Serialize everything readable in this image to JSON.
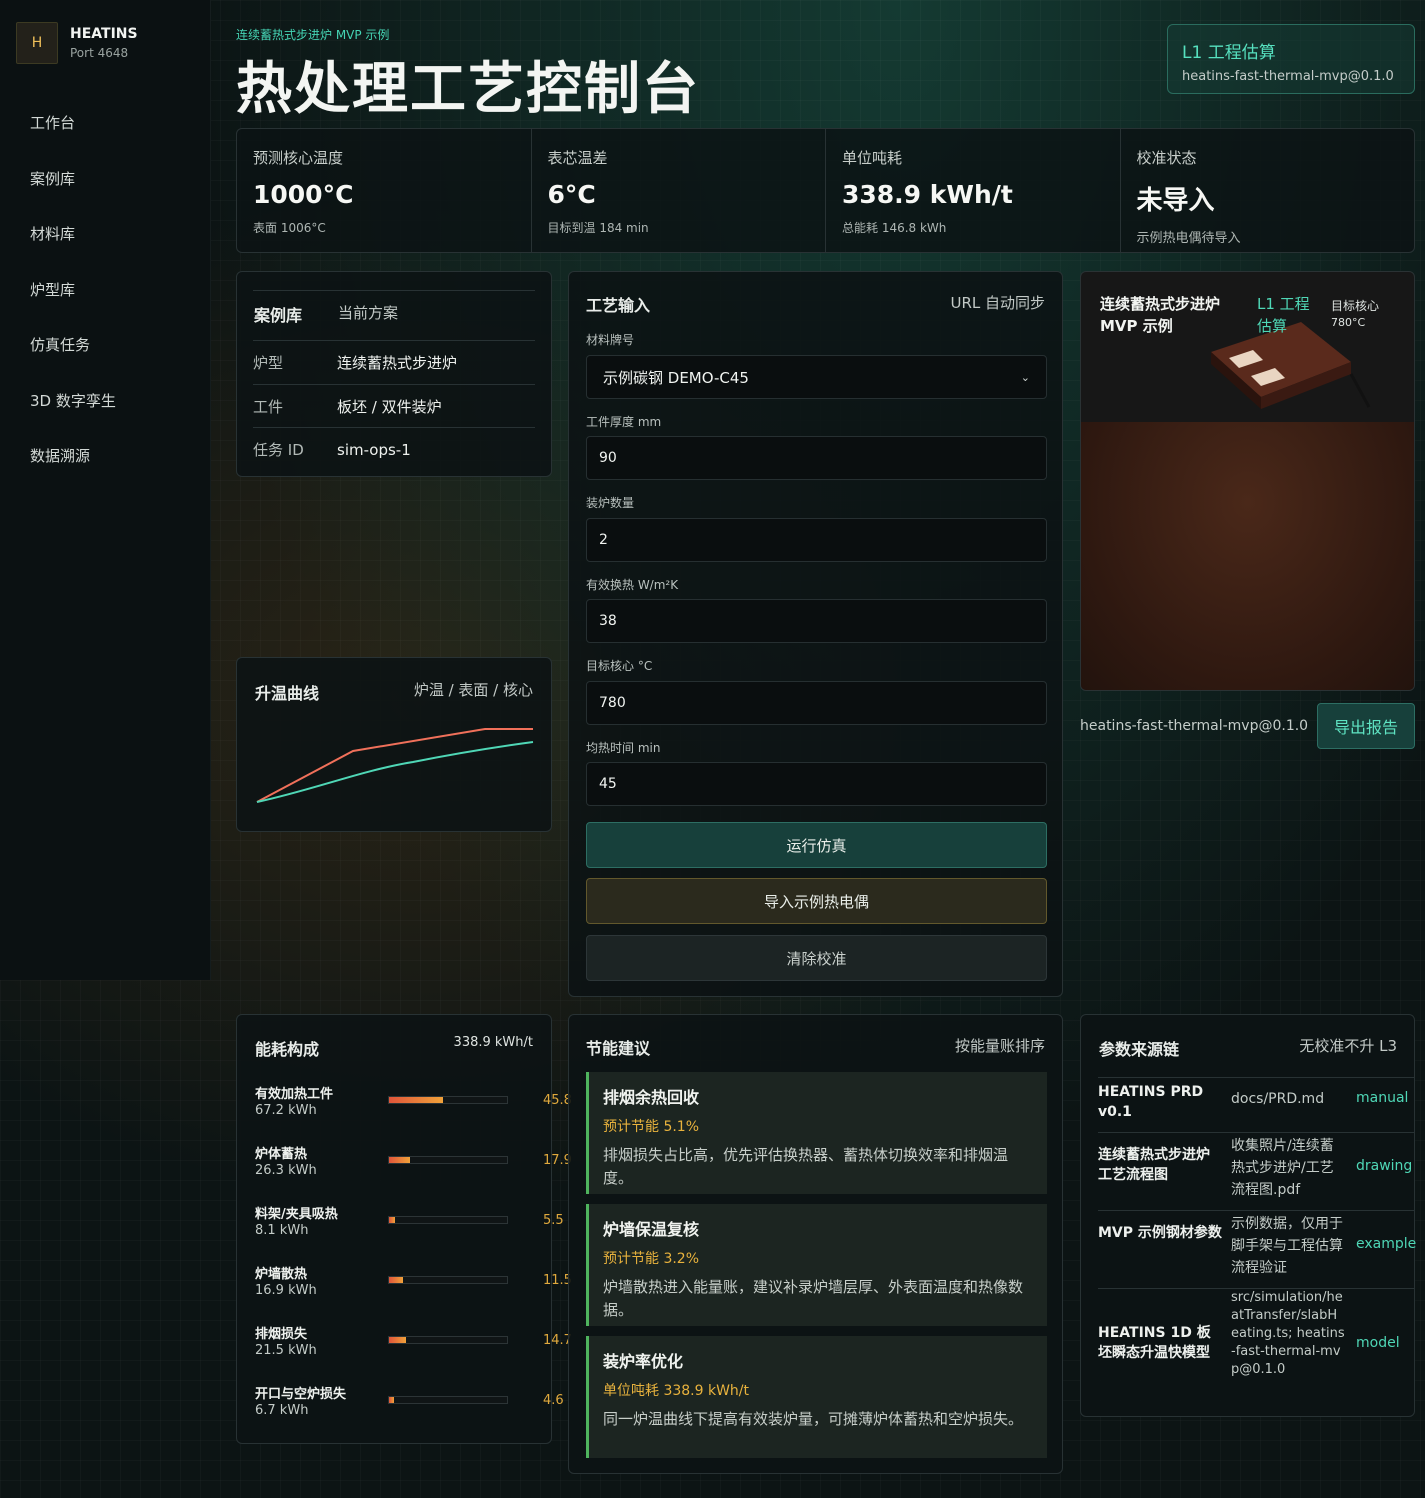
{
  "sidebar": {
    "logo_letter": "H",
    "brand": "HEATINS",
    "port": "Port 4648",
    "items": [
      "工作台",
      "案例库",
      "材料库",
      "炉型库",
      "仿真任务",
      "3D 数字孪生",
      "数据溯源"
    ]
  },
  "header": {
    "eyebrow": "连续蓄热式步进炉 MVP 示例",
    "title": "热处理工艺控制台",
    "badge_title": "L1 工程估算",
    "badge_sub": "heatins-fast-thermal-mvp@0.1.0"
  },
  "metrics": [
    {
      "label": "预测核心温度",
      "value": "1000°C",
      "sub": "表面 1006°C"
    },
    {
      "label": "表芯温差",
      "value": "6°C",
      "sub": "目标到温 184 min"
    },
    {
      "label": "单位吨耗",
      "value": "338.9 kWh/t",
      "sub": "总能耗 146.8 kWh"
    },
    {
      "label": "校准状态",
      "value": "未导入",
      "sub": "示例热电偶待导入"
    }
  ],
  "case": {
    "title": "案例库",
    "title_right": "当前方案",
    "rows": [
      {
        "k": "炉型",
        "v": "连续蓄热式步进炉"
      },
      {
        "k": "工件",
        "v": "板坯 / 双件装炉"
      },
      {
        "k": "任务 ID",
        "v": "sim-ops-1"
      }
    ]
  },
  "curve": {
    "title": "升温曲线",
    "legend": "炉温 / 表面 / 核心",
    "colors": {
      "furnace": "#f0705a",
      "core": "#4fd7b6"
    }
  },
  "process": {
    "title": "工艺输入",
    "sync": "URL 自动同步",
    "material_label": "材料牌号",
    "material_value": "示例碳钢 DEMO-C45",
    "fields": [
      {
        "label": "工件厚度 mm",
        "value": "90"
      },
      {
        "label": "装炉数量",
        "value": "2"
      },
      {
        "label": "有效换热 W/m²K",
        "value": "38"
      },
      {
        "label": "目标核心 °C",
        "value": "780"
      },
      {
        "label": "均热时间 min",
        "value": "45"
      }
    ],
    "run": "运行仿真",
    "import": "导入示例热电偶",
    "clear": "清除校准"
  },
  "twin": {
    "title": "连续蓄热式步进炉 MVP 示例",
    "tag": "L1 工程估算",
    "target_label": "目标核心",
    "target_value": "780°C",
    "version": "heatins-fast-thermal-mvp@0.1.0",
    "export": "导出报告"
  },
  "energy": {
    "title": "能耗构成",
    "total": "338.9 kWh/t",
    "items": [
      {
        "name": "有效加热工件",
        "value": "67.2 kWh",
        "pct": "45.8",
        "ratio": 0.458
      },
      {
        "name": "炉体蓄热",
        "value": "26.3 kWh",
        "pct": "17.9",
        "ratio": 0.179
      },
      {
        "name": "料架/夹具吸热",
        "value": "8.1 kWh",
        "pct": "5.5",
        "ratio": 0.055
      },
      {
        "name": "炉墙散热",
        "value": "16.9 kWh",
        "pct": "11.5",
        "ratio": 0.115
      },
      {
        "name": "排烟损失",
        "value": "21.5 kWh",
        "pct": "14.7",
        "ratio": 0.147
      },
      {
        "name": "开口与空炉损失",
        "value": "6.7 kWh",
        "pct": "4.6",
        "ratio": 0.046
      }
    ]
  },
  "saving": {
    "title": "节能建议",
    "sort": "按能量账排序",
    "tips": [
      {
        "title": "排烟余热回收",
        "est": "预计节能 5.1%",
        "desc": "排烟损失占比高，优先评估换热器、蓄热体切换效率和排烟温度。"
      },
      {
        "title": "炉墙保温复核",
        "est": "预计节能 3.2%",
        "desc": "炉墙散热进入能量账，建议补录炉墙层厚、外表面温度和热像数据。"
      },
      {
        "title": "装炉率优化",
        "est": "单位吨耗 338.9 kWh/t",
        "desc": "同一炉温曲线下提高有效装炉量，可摊薄炉体蓄热和空炉损失。"
      }
    ]
  },
  "sources": {
    "title": "参数来源链",
    "note": "无校准不升 L3",
    "rows": [
      {
        "k": "HEATINS PRD v0.1",
        "m": "docs/PRD.md",
        "t": "manual"
      },
      {
        "k": "连续蓄热式步进炉工艺流程图",
        "m": "收集照片/连续蓄热式步进炉/工艺流程图.pdf",
        "t": "drawing"
      },
      {
        "k": "MVP 示例钢材参数",
        "m": "示例数据，仅用于脚手架与工程估算流程验证",
        "t": "example"
      },
      {
        "k": "HEATINS 1D 板坯瞬态升温快模型",
        "m": "src/simulation/heatTransfer/slabHeating.ts; heatins-fast-thermal-mvp@0.1.0",
        "t": "model"
      }
    ]
  }
}
